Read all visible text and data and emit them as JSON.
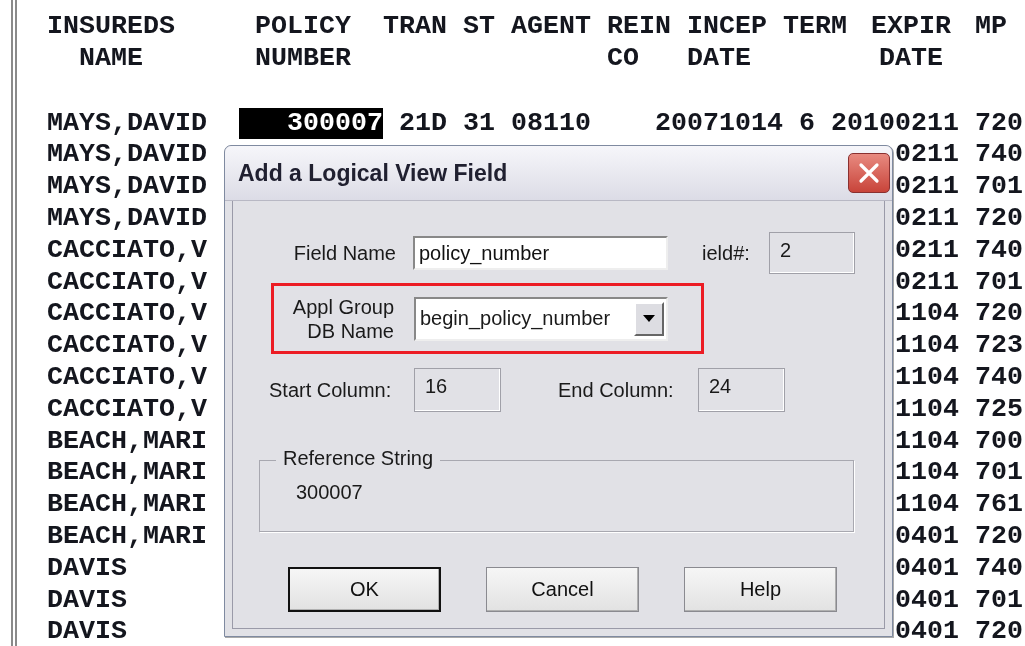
{
  "report": {
    "columns": [
      {
        "heading": [
          "INSUREDS",
          "NAME"
        ]
      },
      {
        "heading": [
          "POLICY",
          "NUMBER"
        ]
      },
      {
        "heading": [
          "TRAN"
        ]
      },
      {
        "heading": [
          "ST"
        ]
      },
      {
        "heading": [
          "AGENT"
        ]
      },
      {
        "heading": [
          "REIN",
          "CO"
        ]
      },
      {
        "heading": [
          "INCEP",
          "DATE"
        ]
      },
      {
        "heading": [
          "TERM"
        ]
      },
      {
        "heading": [
          "EXPIR",
          "DATE"
        ]
      },
      {
        "heading": [
          "MP"
        ]
      }
    ],
    "rows": [
      {
        "insureds_name": "MAYS,DAVID",
        "policy_number": "300007",
        "selected": true,
        "tran": "21D",
        "st": "31",
        "agent": "08110",
        "incep_date": "20071014",
        "term": "6",
        "expir_date": "20100211",
        "mp": "720"
      },
      {
        "insureds_name": "MAYS,DAVID",
        "selected": false,
        "expir_date": "0211",
        "mp": "740"
      },
      {
        "insureds_name": "MAYS,DAVID",
        "selected": false,
        "expir_date": "0211",
        "mp": "701"
      },
      {
        "insureds_name": "MAYS,DAVID",
        "selected": false,
        "expir_date": "0211",
        "mp": "720"
      },
      {
        "insureds_name": "CACCIATO,V",
        "selected": false,
        "expir_date": "0211",
        "mp": "740"
      },
      {
        "insureds_name": "CACCIATO,V",
        "selected": false,
        "expir_date": "0211",
        "mp": "701"
      },
      {
        "insureds_name": "CACCIATO,V",
        "selected": false,
        "expir_date": "1104",
        "mp": "720"
      },
      {
        "insureds_name": "CACCIATO,V",
        "selected": false,
        "expir_date": "1104",
        "mp": "723"
      },
      {
        "insureds_name": "CACCIATO,V",
        "selected": false,
        "expir_date": "1104",
        "mp": "740"
      },
      {
        "insureds_name": "CACCIATO,V",
        "selected": false,
        "expir_date": "1104",
        "mp": "725"
      },
      {
        "insureds_name": "BEACH,MARI",
        "selected": false,
        "expir_date": "1104",
        "mp": "700"
      },
      {
        "insureds_name": "BEACH,MARI",
        "selected": false,
        "expir_date": "1104",
        "mp": "701"
      },
      {
        "insureds_name": "BEACH,MARI",
        "selected": false,
        "expir_date": "1104",
        "mp": "761"
      },
      {
        "insureds_name": "BEACH,MARI",
        "selected": false,
        "expir_date": "0401",
        "mp": "720"
      },
      {
        "insureds_name": "DAVIS",
        "selected": false,
        "expir_date": "0401",
        "mp": "740"
      },
      {
        "insureds_name": "DAVIS",
        "selected": false,
        "expir_date": "0401",
        "mp": "701"
      },
      {
        "insureds_name": "DAVIS",
        "selected": false,
        "expir_date": "0401",
        "mp": "720"
      }
    ]
  },
  "dialog": {
    "title": "Add a Logical View Field",
    "field_name": {
      "label": "Field Name",
      "value": "policy_number"
    },
    "field_number": {
      "label": "ield#:",
      "value": "2"
    },
    "appl_group_db_name": {
      "label": [
        "Appl Group",
        "DB Name"
      ],
      "value": "begin_policy_number"
    },
    "start_column": {
      "label": "Start Column:",
      "value": "16"
    },
    "end_column": {
      "label": "End Column:",
      "value": "24"
    },
    "reference_string": {
      "label": "Reference String",
      "value": "300007"
    },
    "buttons": [
      {
        "label": "OK",
        "default": true
      },
      {
        "label": "Cancel",
        "default": false
      },
      {
        "label": "Help",
        "default": false
      }
    ]
  }
}
